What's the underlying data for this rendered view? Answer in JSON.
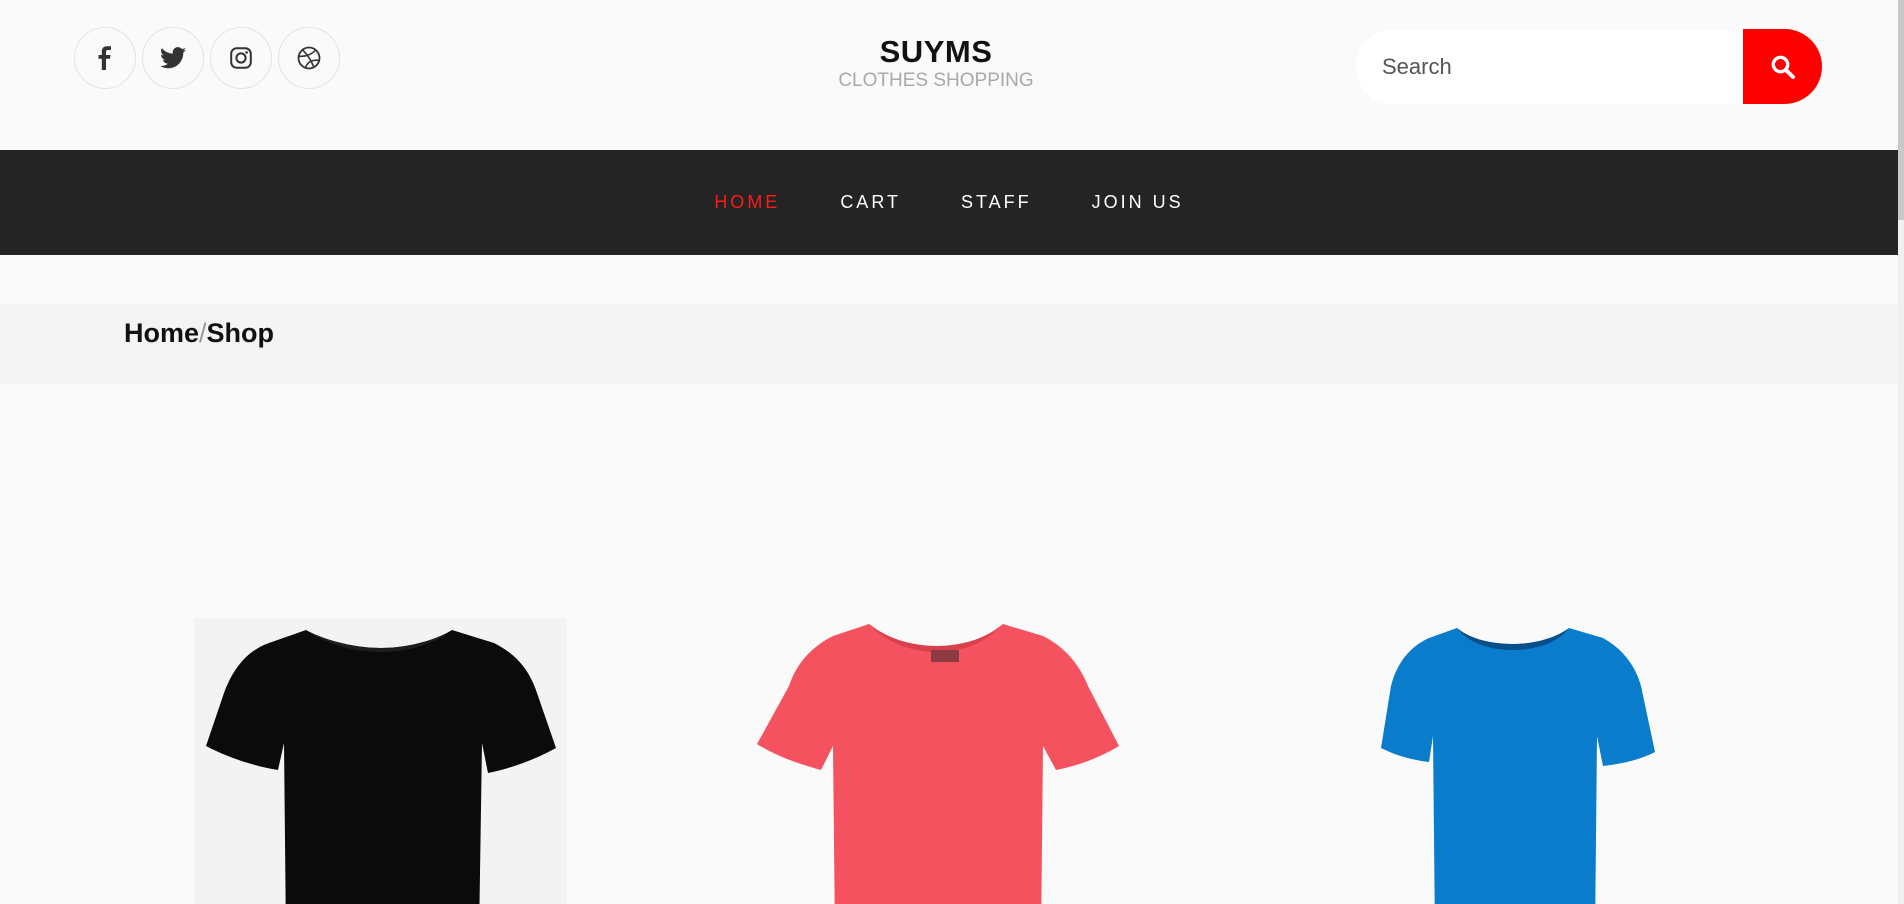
{
  "header": {
    "socials": [
      {
        "icon": "facebook-icon"
      },
      {
        "icon": "twitter-icon"
      },
      {
        "icon": "instagram-icon"
      },
      {
        "icon": "dribbble-icon"
      }
    ],
    "brand_title": "SUYMS",
    "brand_subtitle": "CLOTHES SHOPPING",
    "search": {
      "placeholder": "Search",
      "value": "",
      "button_icon": "search-icon"
    }
  },
  "nav": {
    "items": [
      {
        "label": "HOME",
        "active": true
      },
      {
        "label": "CART",
        "active": false
      },
      {
        "label": "STAFF",
        "active": false
      },
      {
        "label": "JOIN US",
        "active": false
      }
    ]
  },
  "breadcrumb": {
    "home": "Home",
    "separator": "/",
    "current": "Shop"
  },
  "products": [
    {
      "color": "black"
    },
    {
      "color": "red"
    },
    {
      "color": "blue"
    }
  ],
  "colors": {
    "accent": "#ff0000",
    "nav_background": "#242424",
    "nav_text": "#ffffff",
    "nav_active": "#ff1a1a",
    "page_background": "#fafafa",
    "breadcrumb_background": "#f4f4f4",
    "shirt_black": "#0a0a0a",
    "shirt_red": "#f4525e",
    "shirt_blue": "#0a7ccc"
  }
}
